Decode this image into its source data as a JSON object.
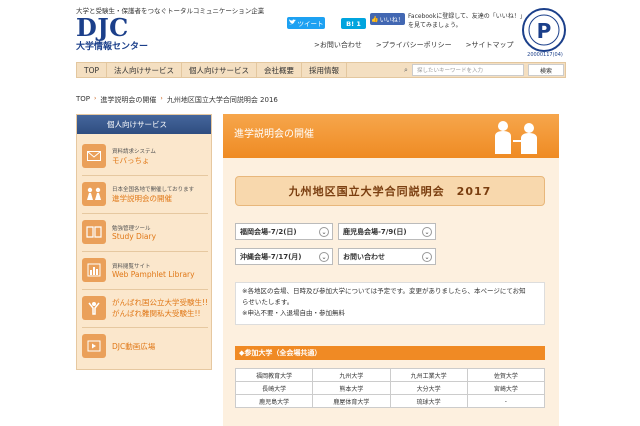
{
  "header": {
    "tagline": "大学と受験生・保護者をつなぐトータルコミュニケーション企業",
    "logo_main": "DJC",
    "logo_sub": "大学情報センター",
    "privacy_number": "20000117(04)"
  },
  "social": {
    "tweet_label": "ツイート",
    "hatena_label": "B! 1",
    "fb_like_label": "いいね！",
    "fb_text": "Facebookに登録して、友達の「いいね！」を見てみましょう。"
  },
  "util_links": [
    "お問い合わせ",
    "プライバシーポリシー",
    "サイトマップ"
  ],
  "nav": {
    "items": [
      "TOP",
      "法人向けサービス",
      "個人向けサービス",
      "会社概要",
      "採用情報"
    ],
    "search_placeholder": "探したいキーワードを入力",
    "search_button": "検索"
  },
  "breadcrumb": [
    "TOP",
    "進学説明会の開催",
    "九州地区国立大学合同説明会 2016"
  ],
  "sidebar": {
    "heading": "個人向けサービス",
    "items": [
      {
        "small": "資料請求システム",
        "big": "モバっちょ",
        "icon": "mail-icon"
      },
      {
        "small": "日本全国各地で開催しております",
        "big": "進学説明会の開催",
        "icon": "people-icon"
      },
      {
        "small": "勉強管理ツール",
        "big": "Study Diary",
        "icon": "book-icon"
      },
      {
        "small": "資料閲覧サイト",
        "big": "Web Pamphlet Library",
        "icon": "chart-icon"
      },
      {
        "small": "がんばれ国公立大学受験生!!",
        "big": "がんばれ難関私大受験生!!",
        "icon": "cheer-icon"
      },
      {
        "small": "",
        "big": "DJC動画広場",
        "icon": "video-icon"
      }
    ]
  },
  "main": {
    "banner_title": "進学説明会の開催",
    "event_title": "九州地区国立大学合同説明会　2017",
    "venues": [
      "福岡会場-7/2(日)",
      "鹿児島会場-7/9(日)",
      "沖縄会場-7/17(月)",
      "お問い合わせ"
    ],
    "notes": [
      "※各地区の会場、日時及び参加大学については予定です。変更がありましたら、本ページにてお知",
      "らせいたします。",
      "※申込不要・入退場自由・参加無料"
    ],
    "section_title": "◆参加大学（全会場共通）",
    "universities": [
      [
        "福岡教育大学",
        "九州大学",
        "九州工業大学",
        "佐賀大学"
      ],
      [
        "長崎大学",
        "熊本大学",
        "大分大学",
        "宮崎大学"
      ],
      [
        "鹿児島大学",
        "鹿屋体育大学",
        "琉球大学",
        "-"
      ]
    ]
  },
  "colors": {
    "brand_blue": "#1b3f8a",
    "accent_orange": "#f08a24",
    "sidebar_bg": "#fbe7cc"
  }
}
